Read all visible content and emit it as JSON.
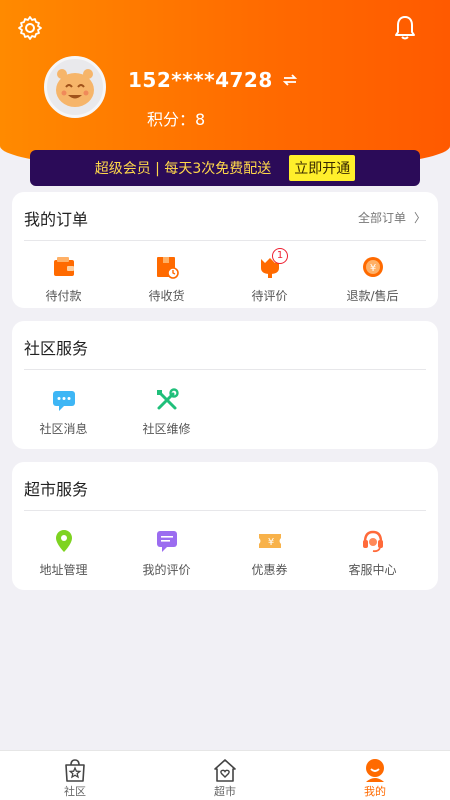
{
  "user": {
    "phone": "152****4728",
    "points_label": "积分：",
    "points_value": "8"
  },
  "vip": {
    "text": "超级会员 | 每天3次免费配送",
    "button": "立即开通"
  },
  "orders": {
    "title": "我的订单",
    "all_label": "全部订单",
    "all_arrow": "〉",
    "items": [
      {
        "label": "待付款",
        "icon": "wallet-icon"
      },
      {
        "label": "待收货",
        "icon": "package-icon"
      },
      {
        "label": "待评价",
        "icon": "review-icon",
        "badge": "1"
      },
      {
        "label": "退款/售后",
        "icon": "refund-icon"
      }
    ]
  },
  "community": {
    "title": "社区服务",
    "items": [
      {
        "label": "社区消息",
        "icon": "message-icon"
      },
      {
        "label": "社区维修",
        "icon": "tools-icon"
      }
    ]
  },
  "market": {
    "title": "超市服务",
    "items": [
      {
        "label": "地址管理",
        "icon": "location-icon"
      },
      {
        "label": "我的评价",
        "icon": "comment-icon"
      },
      {
        "label": "优惠券",
        "icon": "coupon-icon"
      },
      {
        "label": "客服中心",
        "icon": "headset-icon"
      }
    ]
  },
  "tabbar": {
    "items": [
      {
        "label": "社区",
        "icon": "bag-star-icon"
      },
      {
        "label": "超市",
        "icon": "house-heart-icon"
      },
      {
        "label": "我的",
        "icon": "person-icon",
        "active": true
      }
    ]
  },
  "colors": {
    "accent": "#ff6a00",
    "vip_bg": "#2b0b58",
    "vip_text": "#ffd84a",
    "vip_button": "#ffef2b"
  }
}
